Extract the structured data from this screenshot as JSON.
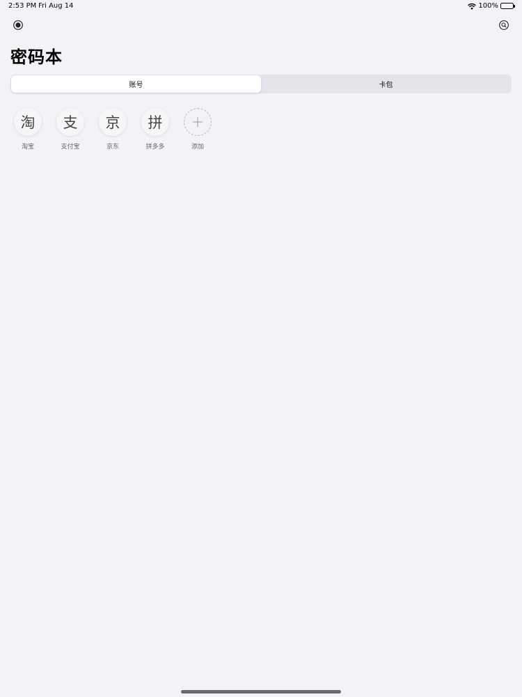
{
  "status_bar": {
    "time": "2:53 PM",
    "date": "Fri Aug 14",
    "battery": "100%"
  },
  "nav": {
    "left_icon": "radio-record-icon",
    "right_icon": "search-circle-icon"
  },
  "page_title": "密码本",
  "segmented": {
    "tabs": [
      {
        "label": "账号"
      },
      {
        "label": "卡包"
      }
    ],
    "selected": "账号"
  },
  "accounts": [
    {
      "glyph": "淘",
      "label": "淘宝"
    },
    {
      "glyph": "支",
      "label": "支付宝"
    },
    {
      "glyph": "京",
      "label": "京东"
    },
    {
      "glyph": "拼",
      "label": "拼多多"
    }
  ],
  "add_item": {
    "glyph": "+",
    "label": "添加"
  }
}
